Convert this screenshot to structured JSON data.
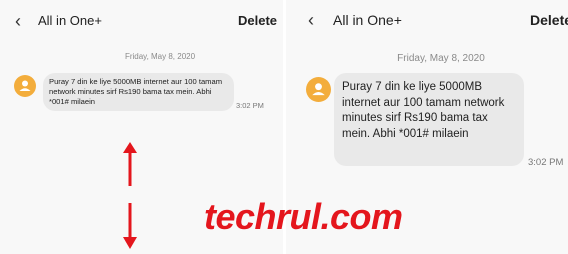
{
  "header": {
    "back_icon": "chevron-left-icon",
    "title": "All in One+",
    "delete_label": "Delete"
  },
  "conversation": {
    "date": "Friday, May 8, 2020",
    "message": "Puray 7 din ke liye 5000MB internet aur 100 tamam network minutes sirf Rs190 bama tax mein. Abhi *001# milaein",
    "time": "3:02 PM",
    "avatar_icon": "person-icon"
  },
  "annotations": {
    "up_arrow": "arrow-up-icon",
    "down_arrow": "arrow-down-icon",
    "arrow_color": "#e4161d"
  },
  "watermark": "techrul.com",
  "colors": {
    "accent_avatar": "#f3ad3c",
    "bubble": "#e9e9e9",
    "watermark": "#e4161d"
  }
}
